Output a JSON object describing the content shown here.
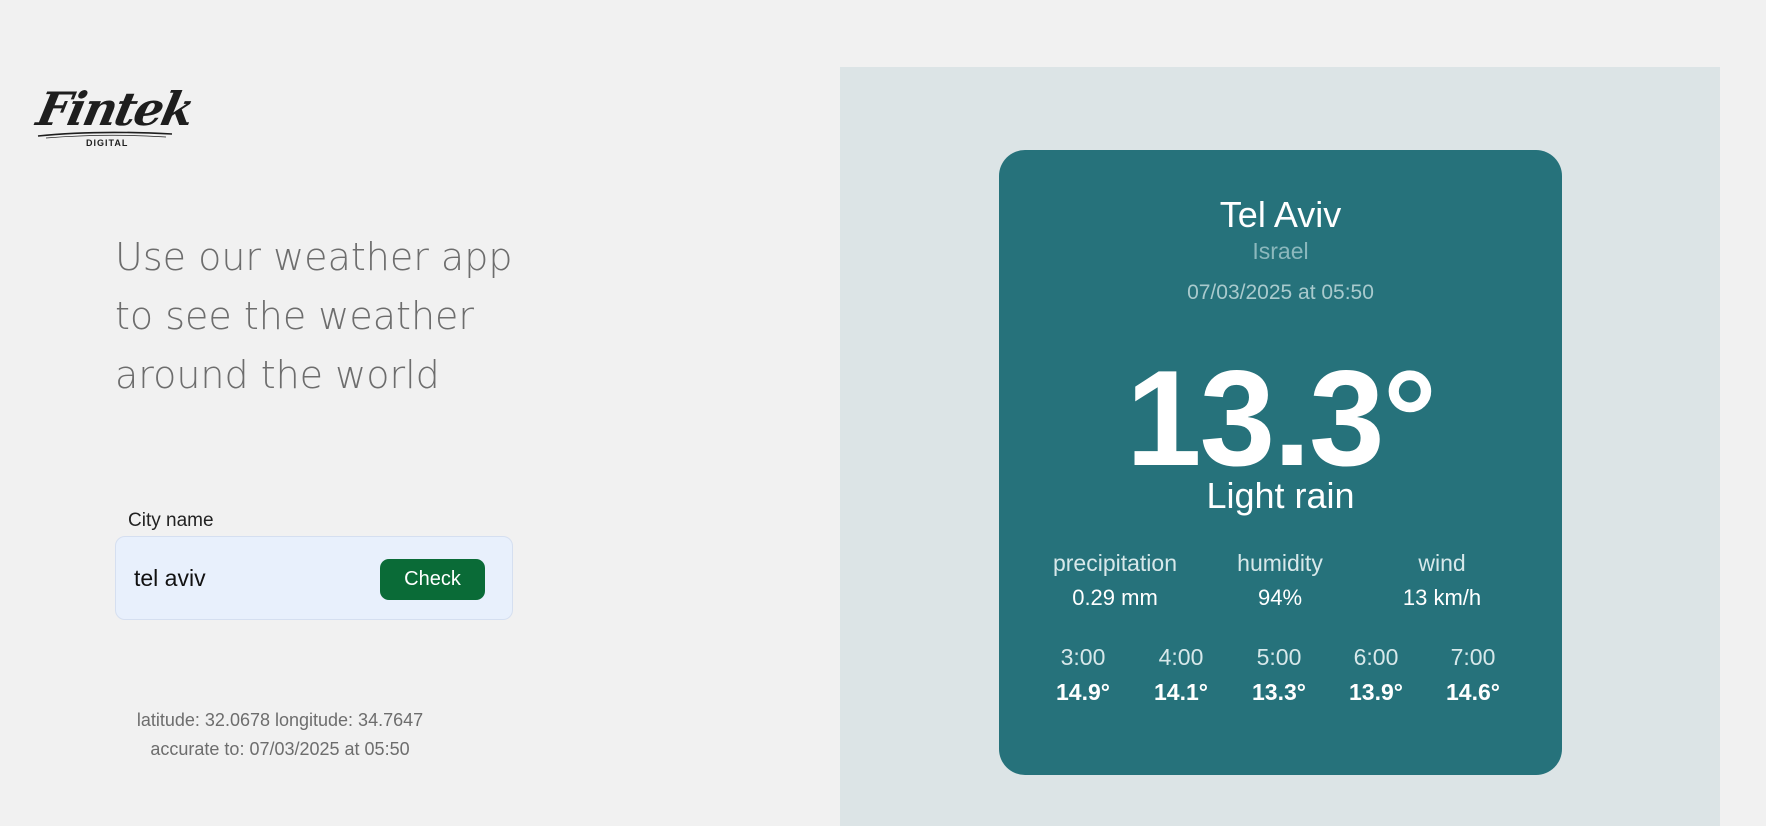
{
  "logo": {
    "text": "Fintek",
    "subtext": "DIGITAL"
  },
  "headline": {
    "line1": "Use our weather app",
    "line2": "to see the weather",
    "line3": "around the world"
  },
  "search": {
    "label": "City name",
    "value": "tel aviv",
    "button_label": "Check"
  },
  "coordinates": {
    "line1": "latitude: 32.0678 longitude: 34.7647",
    "line2": "accurate to: 07/03/2025 at 05:50"
  },
  "weather": {
    "city": "Tel Aviv",
    "country": "Israel",
    "datetime": "07/03/2025 at 05:50",
    "temperature": "13.3°",
    "condition": "Light rain",
    "stats": [
      {
        "label": "precipitation",
        "value": "0.29 mm"
      },
      {
        "label": "humidity",
        "value": "94%"
      },
      {
        "label": "wind",
        "value": "13 km/h"
      }
    ],
    "hourly": [
      {
        "time": "3:00",
        "temp": "14.9°"
      },
      {
        "time": "4:00",
        "temp": "14.1°"
      },
      {
        "time": "5:00",
        "temp": "13.3°"
      },
      {
        "time": "6:00",
        "temp": "13.9°"
      },
      {
        "time": "7:00",
        "temp": "14.6°"
      }
    ]
  },
  "colors": {
    "page_background": "#f1f1f1",
    "panel_background": "#dce4e6",
    "card_background": "#26727b",
    "button_background": "#0a6b37",
    "input_background": "#e8f0fc"
  }
}
